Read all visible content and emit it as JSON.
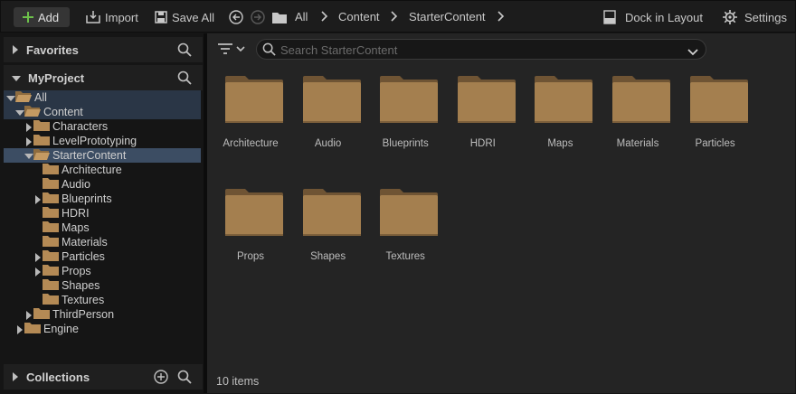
{
  "toolbar": {
    "add_label": "Add",
    "import_label": "Import",
    "save_all_label": "Save All",
    "dock_label": "Dock in Layout",
    "settings_label": "Settings",
    "breadcrumb": [
      "All",
      "Content",
      "StarterContent"
    ]
  },
  "sidebar": {
    "favorites_label": "Favorites",
    "project_label": "MyProject",
    "collections_label": "Collections",
    "tree": [
      {
        "label": "All",
        "depth": 0,
        "expander": "open",
        "folder": "open"
      },
      {
        "label": "Content",
        "depth": 1,
        "expander": "open",
        "folder": "open"
      },
      {
        "label": "Characters",
        "depth": 2,
        "expander": "closed",
        "folder": "closed"
      },
      {
        "label": "LevelPrototyping",
        "depth": 2,
        "expander": "closed",
        "folder": "closed"
      },
      {
        "label": "StarterContent",
        "depth": 2,
        "expander": "open",
        "folder": "open"
      },
      {
        "label": "Architecture",
        "depth": 3,
        "expander": "none",
        "folder": "closed"
      },
      {
        "label": "Audio",
        "depth": 3,
        "expander": "none",
        "folder": "closed"
      },
      {
        "label": "Blueprints",
        "depth": 3,
        "expander": "closed",
        "folder": "closed"
      },
      {
        "label": "HDRI",
        "depth": 3,
        "expander": "none",
        "folder": "closed"
      },
      {
        "label": "Maps",
        "depth": 3,
        "expander": "none",
        "folder": "closed"
      },
      {
        "label": "Materials",
        "depth": 3,
        "expander": "none",
        "folder": "closed"
      },
      {
        "label": "Particles",
        "depth": 3,
        "expander": "closed",
        "folder": "closed"
      },
      {
        "label": "Props",
        "depth": 3,
        "expander": "closed",
        "folder": "closed"
      },
      {
        "label": "Shapes",
        "depth": 3,
        "expander": "none",
        "folder": "closed"
      },
      {
        "label": "Textures",
        "depth": 3,
        "expander": "none",
        "folder": "closed"
      },
      {
        "label": "ThirdPerson",
        "depth": 2,
        "expander": "closed",
        "folder": "closed"
      },
      {
        "label": "Engine",
        "depth": 1,
        "expander": "closed",
        "folder": "closed"
      }
    ]
  },
  "main": {
    "search_placeholder": "Search StarterContent",
    "folders": [
      "Architecture",
      "Audio",
      "Blueprints",
      "HDRI",
      "Maps",
      "Materials",
      "Particles",
      "Props",
      "Shapes",
      "Textures"
    ],
    "item_count": "10 items"
  },
  "colors": {
    "folder": "#a47f4f",
    "selection": "#3c4d63",
    "accent_green": "#6cc04a"
  }
}
